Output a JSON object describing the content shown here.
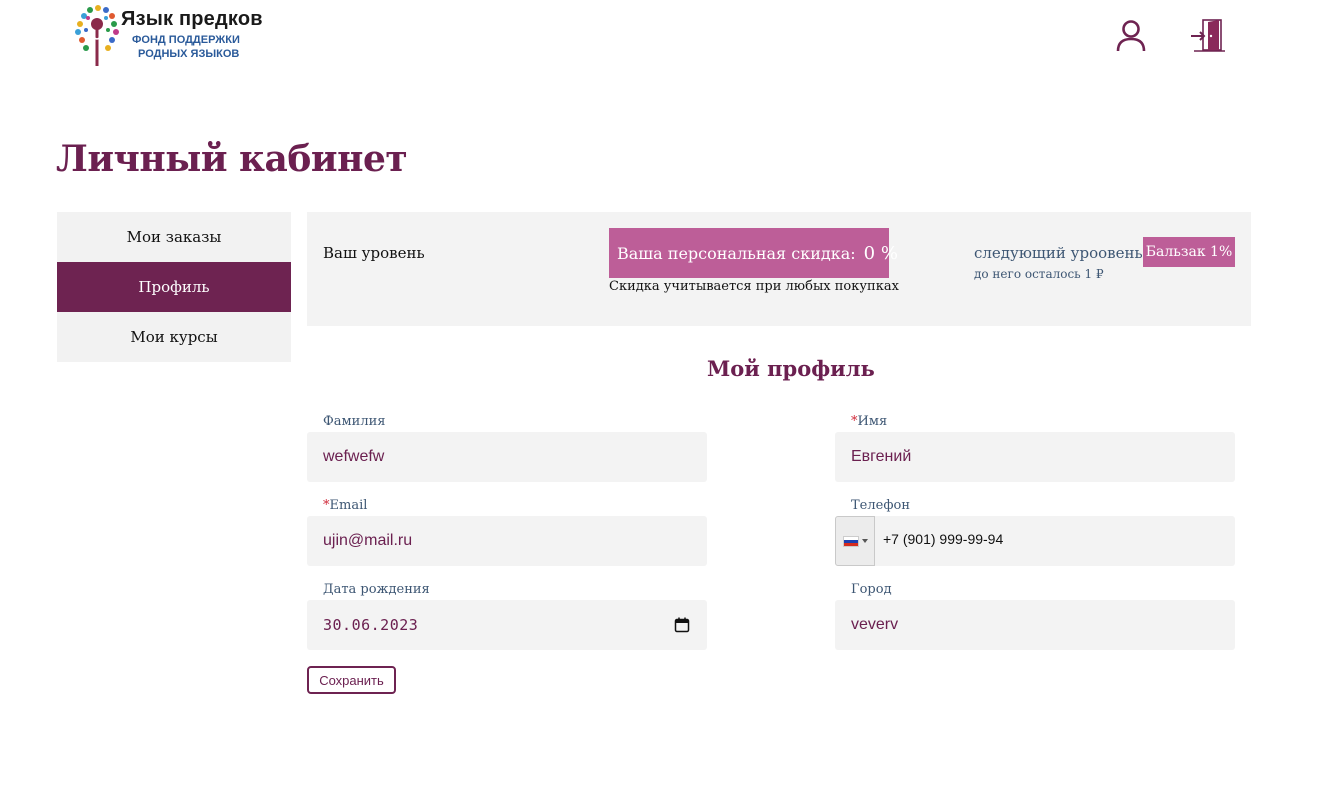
{
  "header": {
    "logo_line1": "Язык предков",
    "logo_line2": "ФОНД ПОДДЕРЖКИ",
    "logo_line3": "РОДНЫХ ЯЗЫКОВ",
    "user_icon": "user-icon",
    "exit_icon": "exit-door-icon"
  },
  "page_title": "Личный кабинет",
  "side_menu": {
    "items": [
      {
        "label": "Мои заказы",
        "active": false
      },
      {
        "label": "Профиль",
        "active": true
      },
      {
        "label": "Мои курсы",
        "active": false
      }
    ]
  },
  "level": {
    "label": "Ваш уровень",
    "discount_label": "Ваша персональная скидка:",
    "discount_value": "0 %",
    "discount_note": "Скидка учитывается при любых покупках",
    "next_level_label": "следующий уроовень",
    "next_level_remaining": "до него осталось 1 ₽",
    "next_level_badge": "Бальзак 1%"
  },
  "profile": {
    "title": "Мой профиль",
    "lastname": {
      "label": "Фамилия",
      "value": "wefwefw",
      "required": false
    },
    "firstname": {
      "label": "Имя",
      "value": "Евгений",
      "required": true
    },
    "email": {
      "label": "Email",
      "value": "ujin@mail.ru",
      "required": true
    },
    "phone": {
      "label": "Телефон",
      "value": "+7 (901) 999-99-94",
      "country": "RU"
    },
    "birthdate": {
      "label": "Дата рождения",
      "value": "30.06.2023"
    },
    "city": {
      "label": "Город",
      "value": "veverv"
    },
    "required_mark": "*",
    "save_label": "Сохранить"
  },
  "colors": {
    "brand": "#6e2351",
    "accent": "#bd5e98",
    "label": "#3d5673",
    "panel_bg": "#f3f3f3"
  }
}
